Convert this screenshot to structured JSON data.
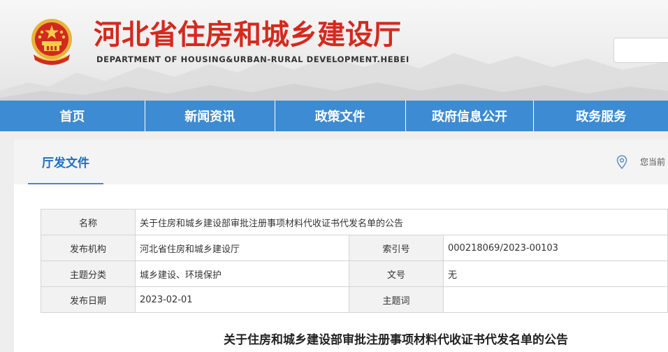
{
  "header": {
    "title": "河北省住房和城乡建设厅",
    "subtitle": "DEPARTMENT OF HOUSING&URBAN-RURAL DEVELOPMENT.HEBEI",
    "search_placeholder": ""
  },
  "nav": {
    "items": [
      {
        "label": "首页"
      },
      {
        "label": "新闻资讯"
      },
      {
        "label": "政策文件"
      },
      {
        "label": "政府信息公开"
      },
      {
        "label": "政务服务"
      }
    ]
  },
  "section": {
    "tab_label": "厅发文件",
    "location_prefix": "您当前"
  },
  "info": {
    "name_label": "名称",
    "name_value": "关于住房和城乡建设部审批注册事项材料代收证书代发名单的公告",
    "publisher_label": "发布机构",
    "publisher_value": "河北省住房和城乡建设厅",
    "index_label": "索引号",
    "index_value": "000218069/2023-00103",
    "category_label": "主题分类",
    "category_value": "城乡建设、环境保护",
    "docno_label": "文号",
    "docno_value": "无",
    "date_label": "发布日期",
    "date_value": "2023-02-01",
    "keyword_label": "主题词",
    "keyword_value": ""
  },
  "document": {
    "title": "关于住房和城乡建设部审批注册事项材料代收证书代发名单的公告"
  },
  "colors": {
    "brand_red": "#d42a1e",
    "nav_blue": "#3d8bd2",
    "tab_blue": "#1f6fbf"
  }
}
